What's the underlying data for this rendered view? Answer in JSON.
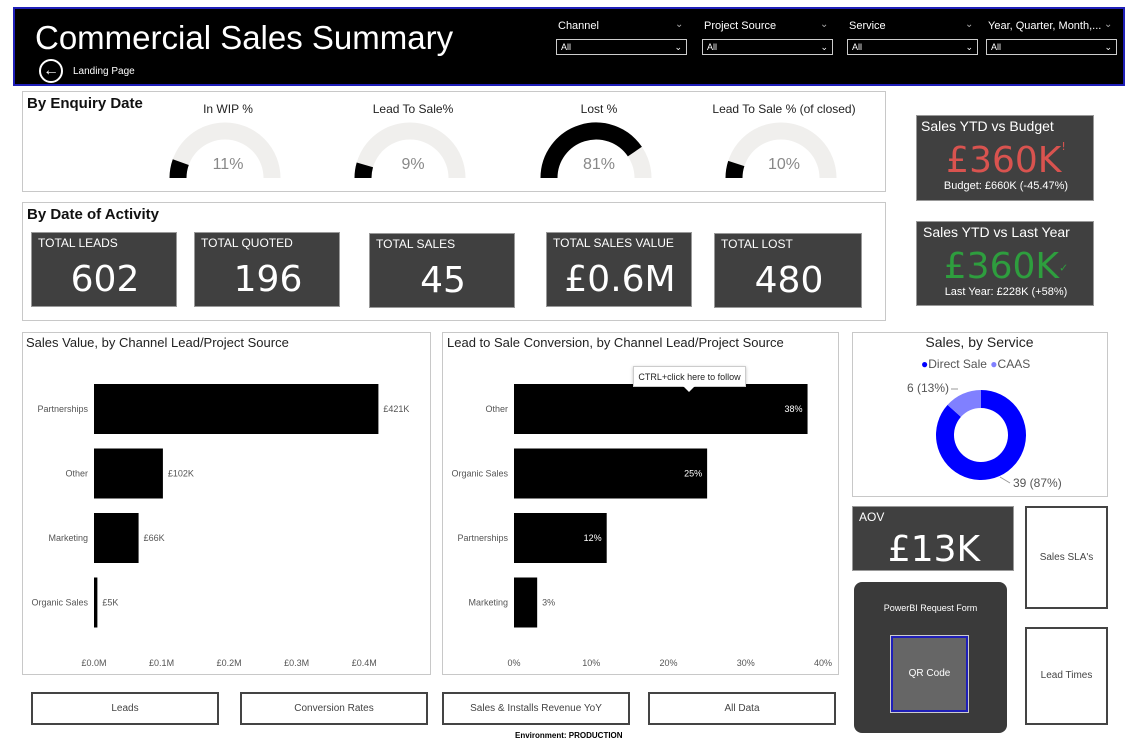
{
  "header": {
    "title": "Commercial Sales Summary",
    "back_label": "Landing Page",
    "slicers": [
      {
        "label": "Channel",
        "value": "All"
      },
      {
        "label": "Project Source",
        "value": "All"
      },
      {
        "label": "Service",
        "value": "All"
      },
      {
        "label": "Year, Quarter, Month,...",
        "value": "All"
      }
    ]
  },
  "enquiry": {
    "title": "By Enquiry Date",
    "gauges": [
      {
        "label": "In WIP %",
        "value_text": "11%",
        "value": 0.11
      },
      {
        "label": "Lead To Sale%",
        "value_text": "9%",
        "value": 0.09
      },
      {
        "label": "Lost %",
        "value_text": "81%",
        "value": 0.81
      },
      {
        "label": "Lead To Sale % (of closed)",
        "value_text": "10%",
        "value": 0.1
      }
    ]
  },
  "activity": {
    "title": "By Date of Activity",
    "kpis": [
      {
        "label": "TOTAL LEADS",
        "value": "602"
      },
      {
        "label": "TOTAL QUOTED",
        "value": "196"
      },
      {
        "label": "TOTAL SALES",
        "value": "45"
      },
      {
        "label": "TOTAL SALES VALUE",
        "value": "£0.6M"
      },
      {
        "label": "TOTAL LOST",
        "value": "480"
      }
    ]
  },
  "ytd_budget": {
    "title": "Sales YTD vs Budget",
    "value": "£360K",
    "sub": "Budget: £660K (-45.47%)",
    "color": "#d9534f",
    "flag": "!"
  },
  "ytd_last_year": {
    "title": "Sales YTD vs Last Year",
    "value": "£360K",
    "sub": "Last Year: £228K (+58%)",
    "color": "#2e9e3e",
    "flag": "✓"
  },
  "tooltip": "CTRL+click here to follow",
  "sales_service": {
    "title": "Sales, by Service",
    "legend": [
      {
        "name": "Direct Sale",
        "color": "#0000ff"
      },
      {
        "name": "CAAS",
        "color": "#8080ff"
      }
    ],
    "label_small": "6 (13%)",
    "label_large": "39 (87%)"
  },
  "aov": {
    "label": "AOV",
    "value": "£13K"
  },
  "side_buttons": {
    "sla": "Sales SLA's",
    "lead_times": "Lead Times"
  },
  "request_form": {
    "title": "PowerBI Request Form",
    "qr_label": "QR Code"
  },
  "nav_buttons": [
    "Leads",
    "Conversion Rates",
    "Sales & Installs Revenue YoY",
    "All Data"
  ],
  "environment": "Environment: PRODUCTION",
  "chart_data": [
    {
      "type": "bar",
      "title": "Sales Value, by Channel Lead/Project Source",
      "orientation": "horizontal",
      "categories": [
        "Partnerships",
        "Other",
        "Marketing",
        "Organic Sales"
      ],
      "values": [
        421,
        102,
        66,
        5
      ],
      "value_labels": [
        "£421K",
        "£102K",
        "£66K",
        "£5K"
      ],
      "unit": "£K",
      "xlim": [
        0,
        450
      ],
      "ticks": [
        0,
        100,
        200,
        300,
        400
      ],
      "tick_labels": [
        "£0.0M",
        "£0.1M",
        "£0.2M",
        "£0.3M",
        "£0.4M"
      ],
      "color": "#000000"
    },
    {
      "type": "bar",
      "title": "Lead to Sale Conversion, by Channel Lead/Project Source",
      "orientation": "horizontal",
      "categories": [
        "Other",
        "Organic Sales",
        "Partnerships",
        "Marketing"
      ],
      "values": [
        38,
        25,
        12,
        3
      ],
      "value_labels": [
        "38%",
        "25%",
        "12%",
        "3%"
      ],
      "unit": "%",
      "xlim": [
        0,
        40
      ],
      "ticks": [
        0,
        10,
        20,
        30,
        40
      ],
      "tick_labels": [
        "0%",
        "10%",
        "20%",
        "30%",
        "40%"
      ],
      "color": "#000000"
    },
    {
      "type": "pie",
      "title": "Sales, by Service",
      "donut": true,
      "categories": [
        "Direct Sale",
        "CAAS"
      ],
      "values": [
        39,
        6
      ]
    }
  ]
}
